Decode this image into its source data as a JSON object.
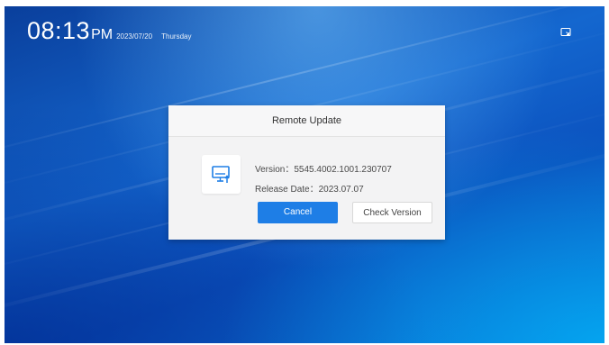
{
  "status_bar": {
    "time": "08:13",
    "ampm": "PM",
    "date": "2023/07/20",
    "weekday": "Thursday",
    "corner_icon": "screen-share-icon"
  },
  "dialog": {
    "title": "Remote Update",
    "icon": "monitor-update-icon",
    "version_label": "Version：",
    "version_value": "5545.4002.1001.230707",
    "release_label": "Release Date：",
    "release_value": "2023.07.07",
    "cancel_label": "Cancel",
    "check_label": "Check Version"
  },
  "colors": {
    "accent": "#1e7ee6",
    "background": "#1467cf",
    "dialog_bg": "#f3f3f4"
  }
}
